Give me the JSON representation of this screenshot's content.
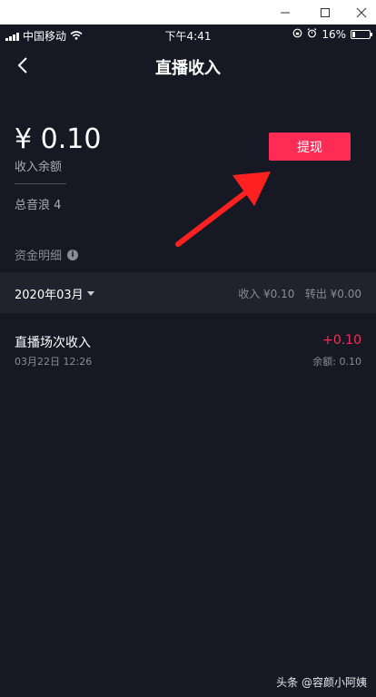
{
  "status_bar": {
    "carrier": "中国移动",
    "time": "下午4:41",
    "battery": "16%",
    "battery_level": 0.16
  },
  "nav": {
    "title": "直播收入"
  },
  "balance": {
    "amount": "¥ 0.10",
    "label": "收入余额",
    "total_sound": "总音浪 4"
  },
  "withdraw_button": "提现",
  "funds_detail": {
    "label": "资金明细"
  },
  "month_bar": {
    "month": "2020年03月",
    "summary": "收入 ¥0.10   转出 ¥0.00"
  },
  "records": [
    {
      "title": "直播场次收入",
      "time": "03月22日 12:26",
      "amount": "+0.10",
      "balance": "余额: 0.10"
    }
  ],
  "watermark": "头条 @容颜小阿姨",
  "colors": {
    "accent": "#fe2c55",
    "background": "#161823",
    "panel": "#20222d"
  }
}
